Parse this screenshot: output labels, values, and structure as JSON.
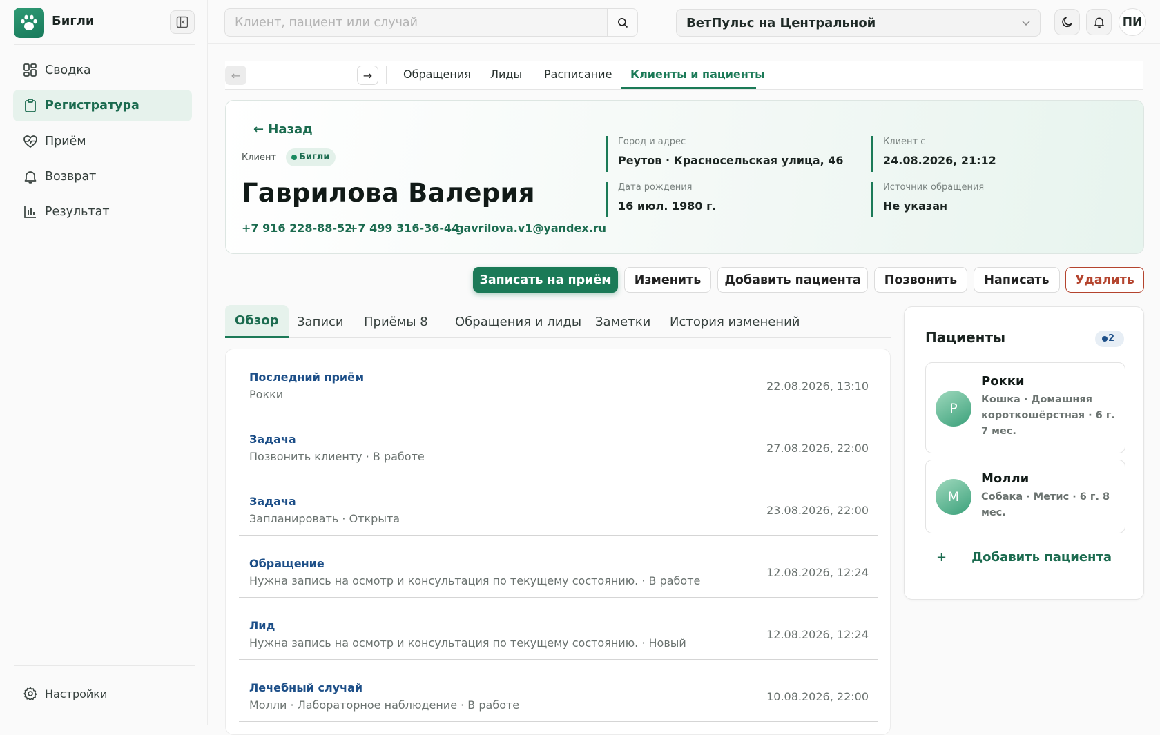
{
  "app": {
    "brand": "Бигли",
    "accent": "#1b7a57",
    "logo_icon": "paw-icon"
  },
  "sidebar": {
    "items": [
      {
        "label": "Сводка",
        "icon": "dashboard-grid-icon",
        "active": false
      },
      {
        "label": "Регистратура",
        "icon": "clipboard-icon",
        "active": true
      },
      {
        "label": "Приём",
        "icon": "heart-pulse-icon",
        "active": false
      },
      {
        "label": "Возврат",
        "icon": "bell-icon",
        "active": false
      },
      {
        "label": "Результат",
        "icon": "bar-chart-icon",
        "active": false
      }
    ],
    "settings_label": "Настройки"
  },
  "topbar": {
    "search_placeholder": "Клиент, пациент или случай",
    "clinic": "ВетПульс на Центральной",
    "user_initials": "ПИ"
  },
  "top_tabs": [
    "Обращения",
    "Лиды",
    "Расписание",
    "Клиенты и пациенты"
  ],
  "top_tabs_active": "Клиенты и пациенты",
  "client": {
    "back": "← Назад",
    "label": "Клиент",
    "badge": "Бигли",
    "name": "Гаврилова Валерия",
    "phone1": "+7 916 228-88-52",
    "phone2": "+7 499 316-36-44",
    "email": "gavrilova.v1@yandex.ru",
    "info": [
      {
        "label": "Город и адрес",
        "value": "Реутов · Красносельская улица, 46"
      },
      {
        "label": "Клиент с",
        "value": "24.08.2026, 21:12"
      },
      {
        "label": "Дата рождения",
        "value": "16 июл. 1980 г."
      },
      {
        "label": "Источник обращения",
        "value": "Не указан"
      }
    ]
  },
  "actions": {
    "book": "Записать на приём",
    "edit": "Изменить",
    "add_patient": "Добавить пациента",
    "call": "Позвонить",
    "write": "Написать",
    "delete": "Удалить"
  },
  "section_tabs": [
    "Обзор",
    "Записи",
    "Приёмы 8",
    "Обращения и лиды",
    "Заметки",
    "История изменений"
  ],
  "section_tabs_active": "Обзор",
  "feed": [
    {
      "title": "Последний приём",
      "sub": "Рокки",
      "date": "22.08.2026, 13:10"
    },
    {
      "title": "Задача",
      "sub": "Позвонить клиенту · В работе",
      "date": "27.08.2026, 22:00"
    },
    {
      "title": "Задача",
      "sub": "Запланировать · Открыта",
      "date": "23.08.2026, 22:00"
    },
    {
      "title": "Обращение",
      "sub": "Нужна запись на осмотр и консультация по текущему состоянию. · В работе",
      "date": "12.08.2026, 12:24"
    },
    {
      "title": "Лид",
      "sub": "Нужна запись на осмотр и консультация по текущему состоянию. · Новый",
      "date": "12.08.2026, 12:24"
    },
    {
      "title": "Лечебный случай",
      "sub": "Молли · Лабораторное наблюдение · В работе",
      "date": "10.08.2026, 22:00"
    }
  ],
  "patients": {
    "title": "Пациенты",
    "count": "2",
    "items": [
      {
        "initial": "Р",
        "name": "Рокки",
        "desc": "Кошка · Домашняя короткошёрстная · 6 г. 7 мес."
      },
      {
        "initial": "М",
        "name": "Молли",
        "desc": "Собака · Метис · 6 г. 8 мес."
      }
    ],
    "add_label": "Добавить пациента",
    "add_icon": "+"
  }
}
